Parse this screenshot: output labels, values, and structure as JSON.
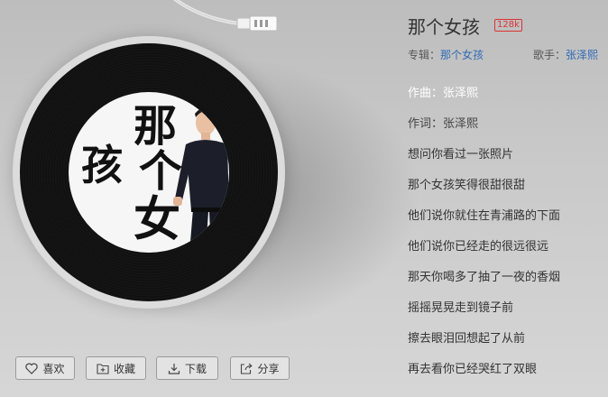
{
  "song": {
    "title": "那个女孩",
    "quality": "128k",
    "album_label": "专辑：",
    "album": "那个女孩",
    "artist_label": "歌手：",
    "artist": "张泽熙"
  },
  "cover": {
    "char1": "那",
    "char2": "个",
    "char3": "女",
    "char4": "孩"
  },
  "lyrics": [
    "作曲：张泽熙",
    "作词：张泽熙",
    "想问你看过一张照片",
    "那个女孩笑得很甜很甜",
    "他们说你就住在青浦路的下面",
    "他们说你已经走的很远很远",
    "那天你喝多了抽了一夜的香烟",
    "摇摇晃晃走到镜子前",
    "擦去眼泪回想起了从前",
    "再去看你已经哭红了双眼"
  ],
  "actions": {
    "like": "喜欢",
    "collect": "收藏",
    "download": "下载",
    "share": "分享"
  },
  "colors": {
    "link": "#2f6ab5",
    "badge": "#dd3333"
  }
}
